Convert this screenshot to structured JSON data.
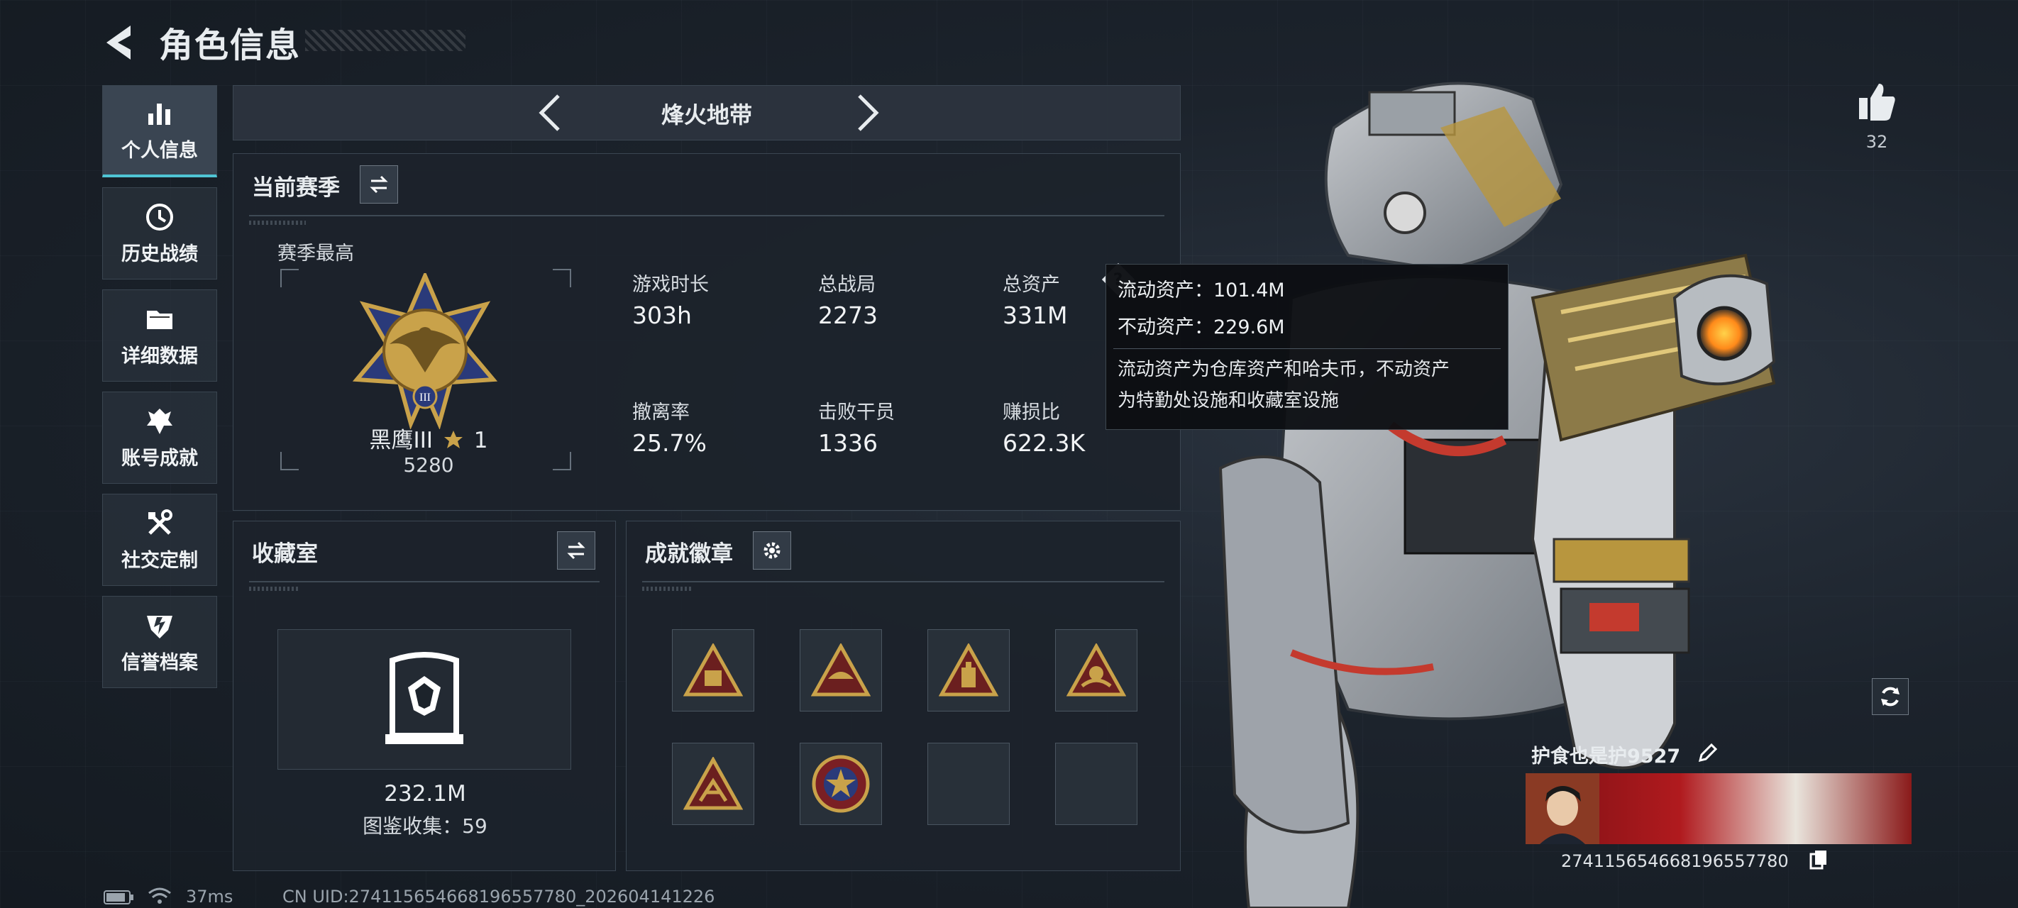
{
  "header": {
    "title": "角色信息"
  },
  "nav": [
    {
      "label": "个人信息",
      "icon": "bar-chart-icon",
      "active": true
    },
    {
      "label": "历史战绩",
      "icon": "history-clock-icon"
    },
    {
      "label": "详细数据",
      "icon": "folder-icon"
    },
    {
      "label": "账号成就",
      "icon": "achievement-icon"
    },
    {
      "label": "社交定制",
      "icon": "tools-icon"
    },
    {
      "label": "信誉档案",
      "icon": "shield-icon"
    }
  ],
  "mode": {
    "title": "烽火地带"
  },
  "season": {
    "title": "当前赛季",
    "peak_label": "赛季最高",
    "rank_name": "黑鹰III",
    "rank_stars": "1",
    "rank_score": "5280",
    "stats": [
      {
        "label": "游戏时长",
        "value": "303h"
      },
      {
        "label": "总战局",
        "value": "2273"
      },
      {
        "label": "总资产",
        "value": "331M"
      },
      {
        "label": "撤离率",
        "value": "25.7%"
      },
      {
        "label": "击败干员",
        "value": "1336"
      },
      {
        "label": "赚损比",
        "value": "622.3K"
      }
    ]
  },
  "tooltip": {
    "liquid": "流动资产：101.4M",
    "fixed": "不动资产：229.6M",
    "desc_line1": "流动资产为仓库资产和哈夫币，不动资产",
    "desc_line2": "为特勤处设施和收藏室设施"
  },
  "collection": {
    "title": "收藏室",
    "value": "232.1M",
    "count_text": "图鉴收集：59"
  },
  "badges": {
    "title": "成就徽章",
    "items": [
      {
        "icon": "badge-sign-icon"
      },
      {
        "icon": "badge-food-icon"
      },
      {
        "icon": "badge-flask-icon"
      },
      {
        "icon": "badge-hands-icon"
      },
      {
        "icon": "badge-spider-icon"
      },
      {
        "icon": "badge-star-medal-icon"
      },
      {
        "icon": "empty-slot"
      },
      {
        "icon": "empty-slot"
      }
    ]
  },
  "player": {
    "likes": "32",
    "name": "护食也是护9527",
    "uid_display": "274115654668196557780"
  },
  "status": {
    "ping": "37ms",
    "uid_line": "CN UID:274115654668196557780_202604141226"
  },
  "colors": {
    "accent": "#4fc4d4",
    "gold": "#c9a24a",
    "panel": "#1c232b"
  }
}
